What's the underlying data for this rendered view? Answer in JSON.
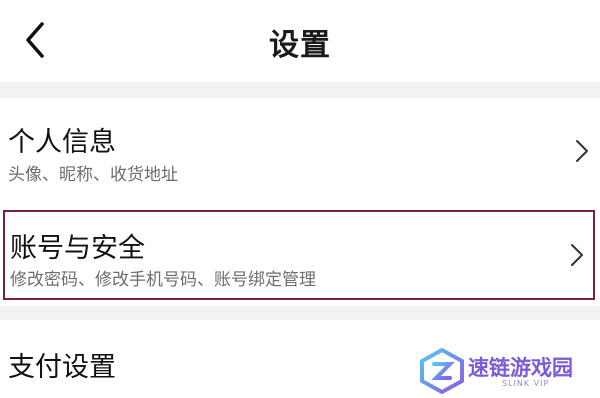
{
  "header": {
    "title": "设置",
    "back_icon": "chevron-left-icon"
  },
  "settings": [
    {
      "title": "个人信息",
      "subtitle": "头像、昵称、收货地址",
      "icon": "chevron-right-icon"
    },
    {
      "title": "账号与安全",
      "subtitle": "修改密码、修改手机号码、账号绑定管理",
      "icon": "chevron-right-icon",
      "highlighted": true,
      "highlight_color": "#7a1f45"
    },
    {
      "title": "支付设置"
    }
  ],
  "watermark": {
    "text": "速链游戏园",
    "subtext": "SLINK VIP",
    "color": "#7c5bd9"
  }
}
